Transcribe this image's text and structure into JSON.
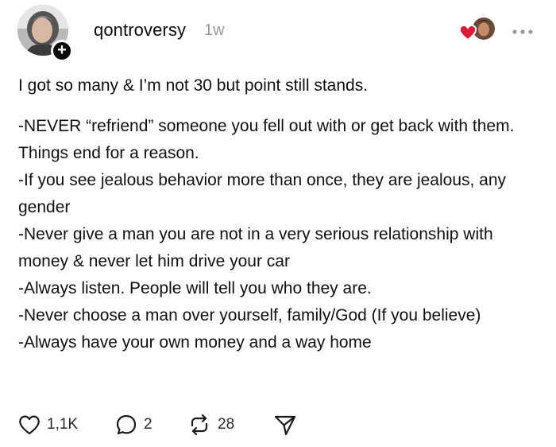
{
  "post": {
    "author": "qontroversy",
    "timestamp": "1w",
    "follow_glyph": "+",
    "intro": "I got so many & I’m not 30 but point still stands.",
    "rules": [
      "-NEVER “refriend” someone you fell out with or get back with them. Things end for a reason.",
      "-If you see jealous behavior more than once, they are jealous, any gender",
      "-Never give a man you are not in a very serious relationship with money & never let him drive your car",
      "-Always listen. People will tell you who they are.",
      "-Never choose a man over yourself, family/God (If you believe)",
      "-Always have your own money and a way home"
    ]
  },
  "actions": {
    "like_count": "1,1K",
    "reply_count": "2",
    "repost_count": "28"
  },
  "icons": {
    "like": "heart-outline-icon",
    "reply": "speech-bubble-icon",
    "repost": "repost-arrows-icon",
    "share": "paper-plane-icon",
    "more": "ellipsis-icon",
    "liked_by": "red-heart-icon"
  },
  "colors": {
    "text": "#101010",
    "secondary": "#999999",
    "liked_heart": "#e0183a"
  }
}
